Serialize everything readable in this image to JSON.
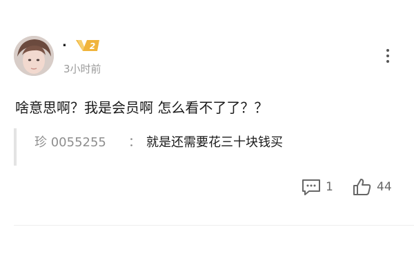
{
  "comment": {
    "username": ".",
    "level": "2",
    "time": "3小时前",
    "text": "啥意思啊？我是会员啊 怎么看不了了？？",
    "reply": {
      "author": "珍 0055255",
      "separator": "：",
      "text": "就是还需要花三十块钱买"
    },
    "actions": {
      "comment_count": "1",
      "like_count": "44"
    },
    "icons": {
      "more": "more-vertical-icon",
      "comment": "comment-icon",
      "like": "thumbs-up-icon",
      "level": "vip-level-badge"
    },
    "colors": {
      "text": "#1a1a1a",
      "muted": "#9a9a9a",
      "badge": "#f0b43c",
      "icon": "#666666"
    }
  }
}
